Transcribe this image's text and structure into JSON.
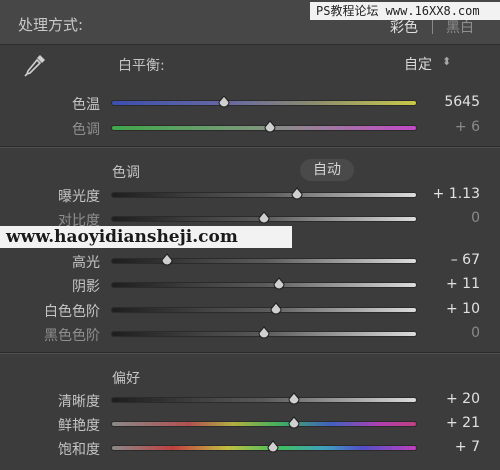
{
  "header": {
    "title": "处理方式:",
    "color_option": "彩色",
    "bw_option": "黑白"
  },
  "watermarks": {
    "top": "PS教程论坛 www.16XX8.com",
    "middle": "www.haoyidiansheji.com"
  },
  "white_balance": {
    "label": "白平衡:",
    "preset": "自定",
    "dropper_icon": "eyedropper-icon",
    "sliders": [
      {
        "label": "色温",
        "value": "5645",
        "pos": 0.37,
        "track": "temp",
        "dim": false
      },
      {
        "label": "色调",
        "value": "+ 6",
        "pos": 0.52,
        "track": "tint",
        "dim": true
      }
    ]
  },
  "tone": {
    "label": "色调",
    "auto_label": "自动",
    "sliders": [
      {
        "label": "曝光度",
        "value": "+ 1.13",
        "pos": 0.61,
        "track": "gray",
        "dim": false
      },
      {
        "label": "对比度",
        "value": "0",
        "pos": 0.5,
        "track": "gray",
        "dim": true
      },
      {
        "label": "高光",
        "value": "– 67",
        "pos": 0.18,
        "track": "gray",
        "dim": false
      },
      {
        "label": "阴影",
        "value": "+ 11",
        "pos": 0.55,
        "track": "gray",
        "dim": false
      },
      {
        "label": "白色色阶",
        "value": "+ 10",
        "pos": 0.54,
        "track": "gray",
        "dim": false
      },
      {
        "label": "黑色色阶",
        "value": "0",
        "pos": 0.5,
        "track": "gray",
        "dim": true
      }
    ]
  },
  "presence": {
    "label": "偏好",
    "sliders": [
      {
        "label": "清晰度",
        "value": "+ 20",
        "pos": 0.6,
        "track": "gray",
        "dim": false
      },
      {
        "label": "鲜艳度",
        "value": "+ 21",
        "pos": 0.6,
        "track": "vibrance",
        "dim": false
      },
      {
        "label": "饱和度",
        "value": "+ 7",
        "pos": 0.53,
        "track": "saturation",
        "dim": false
      }
    ]
  },
  "colors": {
    "background": "#3c3c3c",
    "thumb": "#cfcfcf"
  }
}
